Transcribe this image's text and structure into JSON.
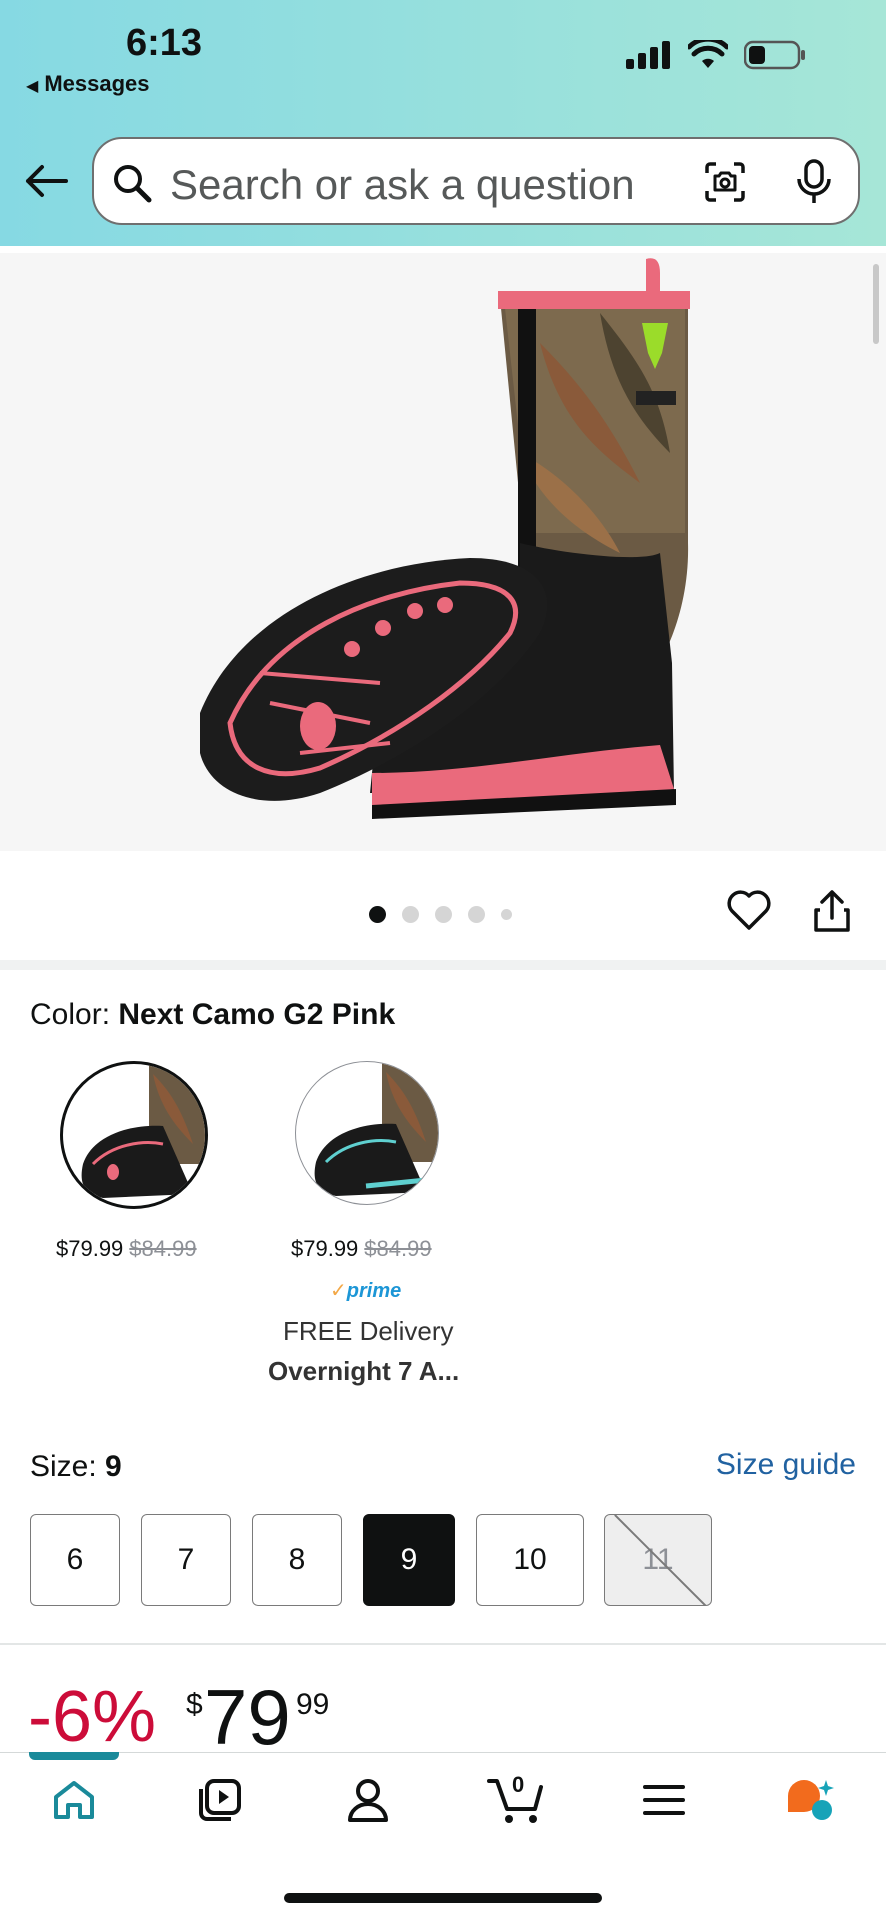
{
  "status_bar": {
    "time": "6:13",
    "back_app": "Messages"
  },
  "search": {
    "placeholder": "Search or ask a question"
  },
  "product": {
    "image_alt": "TIDEWE camo pink rubber boot",
    "image_count": 5,
    "active_image": 1
  },
  "color": {
    "label": "Color:",
    "value": "Next Camo G2 Pink"
  },
  "swatches": [
    {
      "price": "$79.99",
      "list_price": "$84.99"
    },
    {
      "price": "$79.99",
      "list_price": "$84.99",
      "prime": "prime",
      "delivery": "FREE Delivery",
      "delivery_time": "Overnight 7 A..."
    }
  ],
  "size": {
    "label": "Size:",
    "value": "9",
    "guide": "Size guide",
    "options": [
      "6",
      "7",
      "8",
      "9",
      "10",
      "11"
    ]
  },
  "pricing": {
    "discount": "-6%",
    "currency": "$",
    "whole": "79",
    "fraction": "99"
  },
  "nav": {
    "cart_count": "0"
  },
  "colors": {
    "accent": "#1a8a9a",
    "deal_red": "#cc0c39",
    "link": "#2162a1"
  }
}
